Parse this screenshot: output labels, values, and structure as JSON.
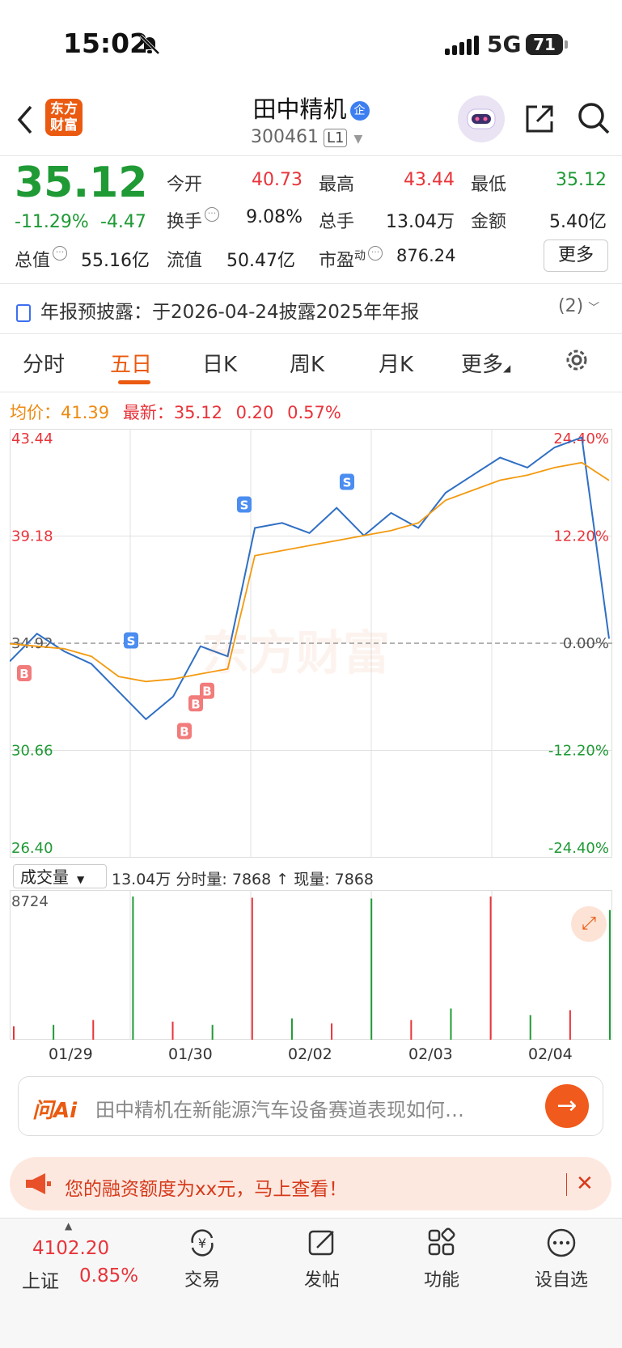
{
  "status_bar": {
    "time": "15:02",
    "network": "5G",
    "battery": "71"
  },
  "header": {
    "app_logo": "东方\n财富",
    "stock_name": "田中精机",
    "ent_badge": "企",
    "stock_code": "300461",
    "level": "L1"
  },
  "quote": {
    "price": "35.12",
    "change_pct": "-11.29%",
    "change": "-4.47",
    "fields": [
      {
        "label": "今开",
        "value": "40.73",
        "color": "red"
      },
      {
        "label": "最高",
        "value": "43.44",
        "color": "red"
      },
      {
        "label": "最低",
        "value": "35.12",
        "color": "green"
      },
      {
        "label": "换手",
        "value": "9.08%",
        "color": "black"
      },
      {
        "label": "总手",
        "value": "13.04万",
        "color": "black"
      },
      {
        "label": "金额",
        "value": "5.40亿",
        "color": "black"
      }
    ],
    "total_value_label": "总值",
    "total_value": "55.16亿",
    "float_label": "流值",
    "float_value": "50.47亿",
    "pe_label": "市盈",
    "pe_sup": "动",
    "pe_value": "876.24",
    "more_button": "更多"
  },
  "notice": {
    "text": "年报预披露：于2026-04-24披露2025年年报",
    "count": "(2)"
  },
  "tabs": [
    "分时",
    "五日",
    "日K",
    "周K",
    "月K",
    "更多"
  ],
  "active_tab": 1,
  "avg_row": {
    "avg_label": "均价：",
    "avg_value": "41.39",
    "latest_label": "最新：",
    "latest_value": "35.12",
    "change": "0.20",
    "pct": "0.57%"
  },
  "chart_data": {
    "type": "line",
    "title": "",
    "x_dates": [
      "01/29",
      "01/30",
      "02/02",
      "02/03",
      "02/04"
    ],
    "y_ticks": [
      "43.44",
      "39.18",
      "34.92",
      "30.66",
      "26.40"
    ],
    "y_pct_ticks": [
      "24.40%",
      "12.20%",
      "0.00%",
      "-12.20%",
      "-24.40%"
    ],
    "ylim": [
      26.4,
      43.44
    ],
    "prev_close": 34.92,
    "series": [
      {
        "name": "价格",
        "color": "#2f6fc4",
        "values": [
          34.2,
          35.3,
          34.6,
          34.1,
          33.0,
          31.9,
          32.8,
          34.8,
          34.4,
          39.5,
          39.7,
          39.3,
          40.3,
          39.2,
          40.1,
          39.5,
          40.9,
          41.6,
          42.3,
          41.9,
          42.7,
          43.1,
          35.1
        ]
      },
      {
        "name": "均价",
        "color": "#f39a10",
        "values": [
          34.9,
          34.8,
          34.7,
          34.4,
          33.6,
          33.4,
          33.5,
          33.7,
          33.9,
          38.4,
          38.6,
          38.8,
          39.0,
          39.2,
          39.4,
          39.7,
          40.6,
          41.0,
          41.4,
          41.6,
          41.9,
          42.1,
          41.39
        ]
      }
    ],
    "signals": [
      "B",
      "S",
      "B",
      "B",
      "B",
      "S",
      "S"
    ],
    "volume_label": "成交量",
    "volume_info": "13.04万 分时量: 7868 ↑ 现量: 7868",
    "volume_max": "8724",
    "volume": [
      820,
      900,
      1200,
      8724,
      1100,
      900,
      8650,
      1300,
      1000,
      8600,
      1200,
      1900,
      8724,
      1500,
      1800,
      7900
    ]
  },
  "ask": {
    "logo": "问Ai",
    "placeholder": "田中精机在新能源汽车设备赛道表现如何…"
  },
  "promo": {
    "text": "您的融资额度为xx元，马上查看！"
  },
  "bottom_nav": {
    "index_value": "4102.20",
    "index_name": "上证",
    "index_pct": "0.85%",
    "items": [
      "交易",
      "发帖",
      "功能",
      "设自选"
    ]
  }
}
